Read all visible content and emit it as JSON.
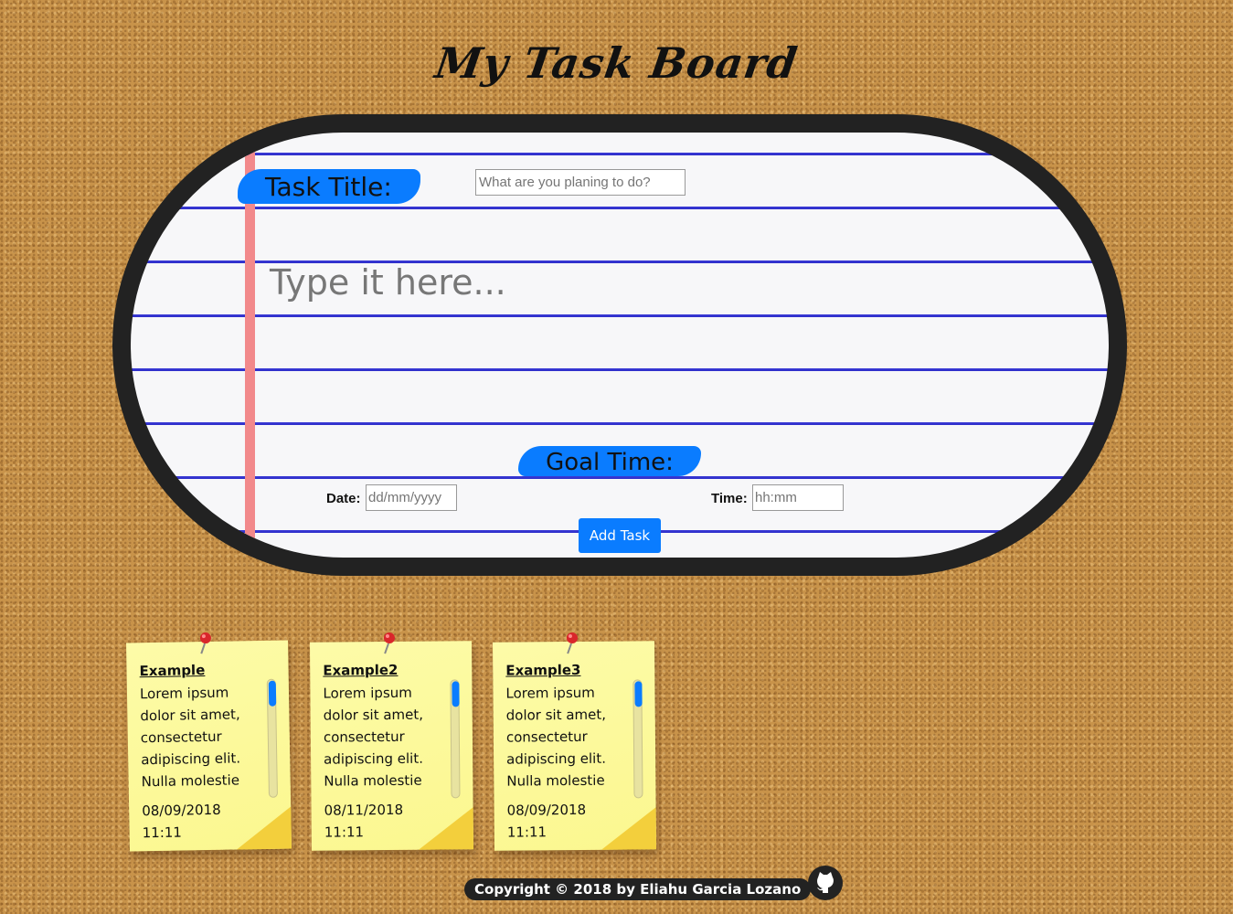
{
  "header": {
    "title": "My Task Board"
  },
  "form": {
    "task_title_label": "Task Title:",
    "task_title_placeholder": "What are you planing to do?",
    "task_body_placeholder": "Type it here...",
    "goal_time_label": "Goal Time:",
    "date_label": "Date:",
    "date_placeholder": "dd/mm/yyyy",
    "time_label": "Time:",
    "time_placeholder": "hh:mm",
    "add_button": "Add Task"
  },
  "notes": [
    {
      "title": "Example",
      "body": "Lorem ipsum dolor sit amet, consectetur adipiscing elit. Nulla molestie",
      "date": "08/09/2018",
      "time": "11:11"
    },
    {
      "title": "Example2",
      "body": "Lorem ipsum dolor sit amet, consectetur adipiscing elit. Nulla molestie",
      "date": "08/11/2018",
      "time": "11:11"
    },
    {
      "title": "Example3",
      "body": "Lorem ipsum dolor sit amet, consectetur adipiscing elit. Nulla molestie",
      "date": "08/09/2018",
      "time": "11:11"
    }
  ],
  "footer": {
    "copyright": "Copyright © 2018 by Eliahu Garcia Lozano",
    "github_icon": "github-icon"
  },
  "colors": {
    "accent": "#0a7cff",
    "board_frame": "#222222",
    "note": "#fdfba8",
    "margin_line": "#f2898b",
    "rule_line": "#3b3bd6"
  }
}
